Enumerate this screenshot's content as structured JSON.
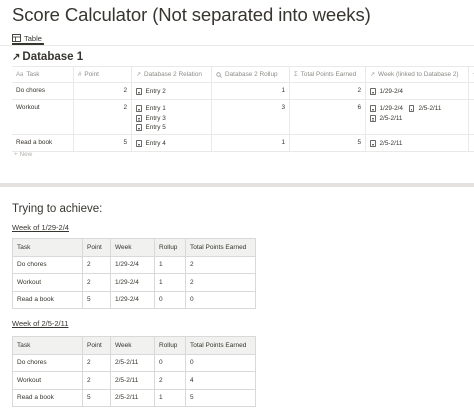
{
  "page": {
    "title": "Score Calculator (Not separated into weeks)"
  },
  "view": {
    "tab_label": "Table"
  },
  "database": {
    "title": "Database 1",
    "columns": [
      {
        "label": "Task",
        "icon": "Aa"
      },
      {
        "label": "Point",
        "icon": "#"
      },
      {
        "label": "Database 2 Relation",
        "icon": "↗"
      },
      {
        "label": "Database 2 Rollup",
        "icon": "search"
      },
      {
        "label": "Total Points Earned",
        "icon": "Σ"
      },
      {
        "label": "Week (linked to Database 2)",
        "icon": "↗"
      }
    ],
    "add_column": "+",
    "rows": [
      {
        "task": "Do chores",
        "point": "2",
        "relation": [
          "Entry 2"
        ],
        "rollup": "1",
        "total": "2",
        "week": [
          "1/29-2/4"
        ]
      },
      {
        "task": "Workout",
        "point": "2",
        "relation": [
          "Entry 1",
          "Entry 3",
          "Entry 5"
        ],
        "rollup": "3",
        "total": "6",
        "week": [
          "1/29-2/4",
          "2/5-2/11",
          "2/5-2/11"
        ]
      },
      {
        "task": "Read a book",
        "point": "5",
        "relation": [
          "Entry 4"
        ],
        "rollup": "1",
        "total": "5",
        "week": [
          "2/5-2/11"
        ]
      }
    ],
    "new_label": "+ New"
  },
  "goal": {
    "heading": "Trying to achieve:",
    "weeks": [
      {
        "label": "Week of 1/29-2/4",
        "headers": [
          "Task",
          "Point",
          "Week",
          "Rollup",
          "Total Points Earned"
        ],
        "rows": [
          [
            "Do chores",
            "2",
            "1/29-2/4",
            "1",
            "2"
          ],
          [
            "Workout",
            "2",
            "1/29-2/4",
            "1",
            "2"
          ],
          [
            "Read a book",
            "5",
            "1/29-2/4",
            "0",
            "0"
          ]
        ]
      },
      {
        "label": "Week of 2/5-2/11",
        "headers": [
          "Task",
          "Point",
          "Week",
          "Rollup",
          "Total Points Earned"
        ],
        "rows": [
          [
            "Do chores",
            "2",
            "2/5-2/11",
            "0",
            "0"
          ],
          [
            "Workout",
            "2",
            "2/5-2/11",
            "2",
            "4"
          ],
          [
            "Read a book",
            "5",
            "2/5-2/11",
            "1",
            "5"
          ]
        ]
      }
    ]
  }
}
